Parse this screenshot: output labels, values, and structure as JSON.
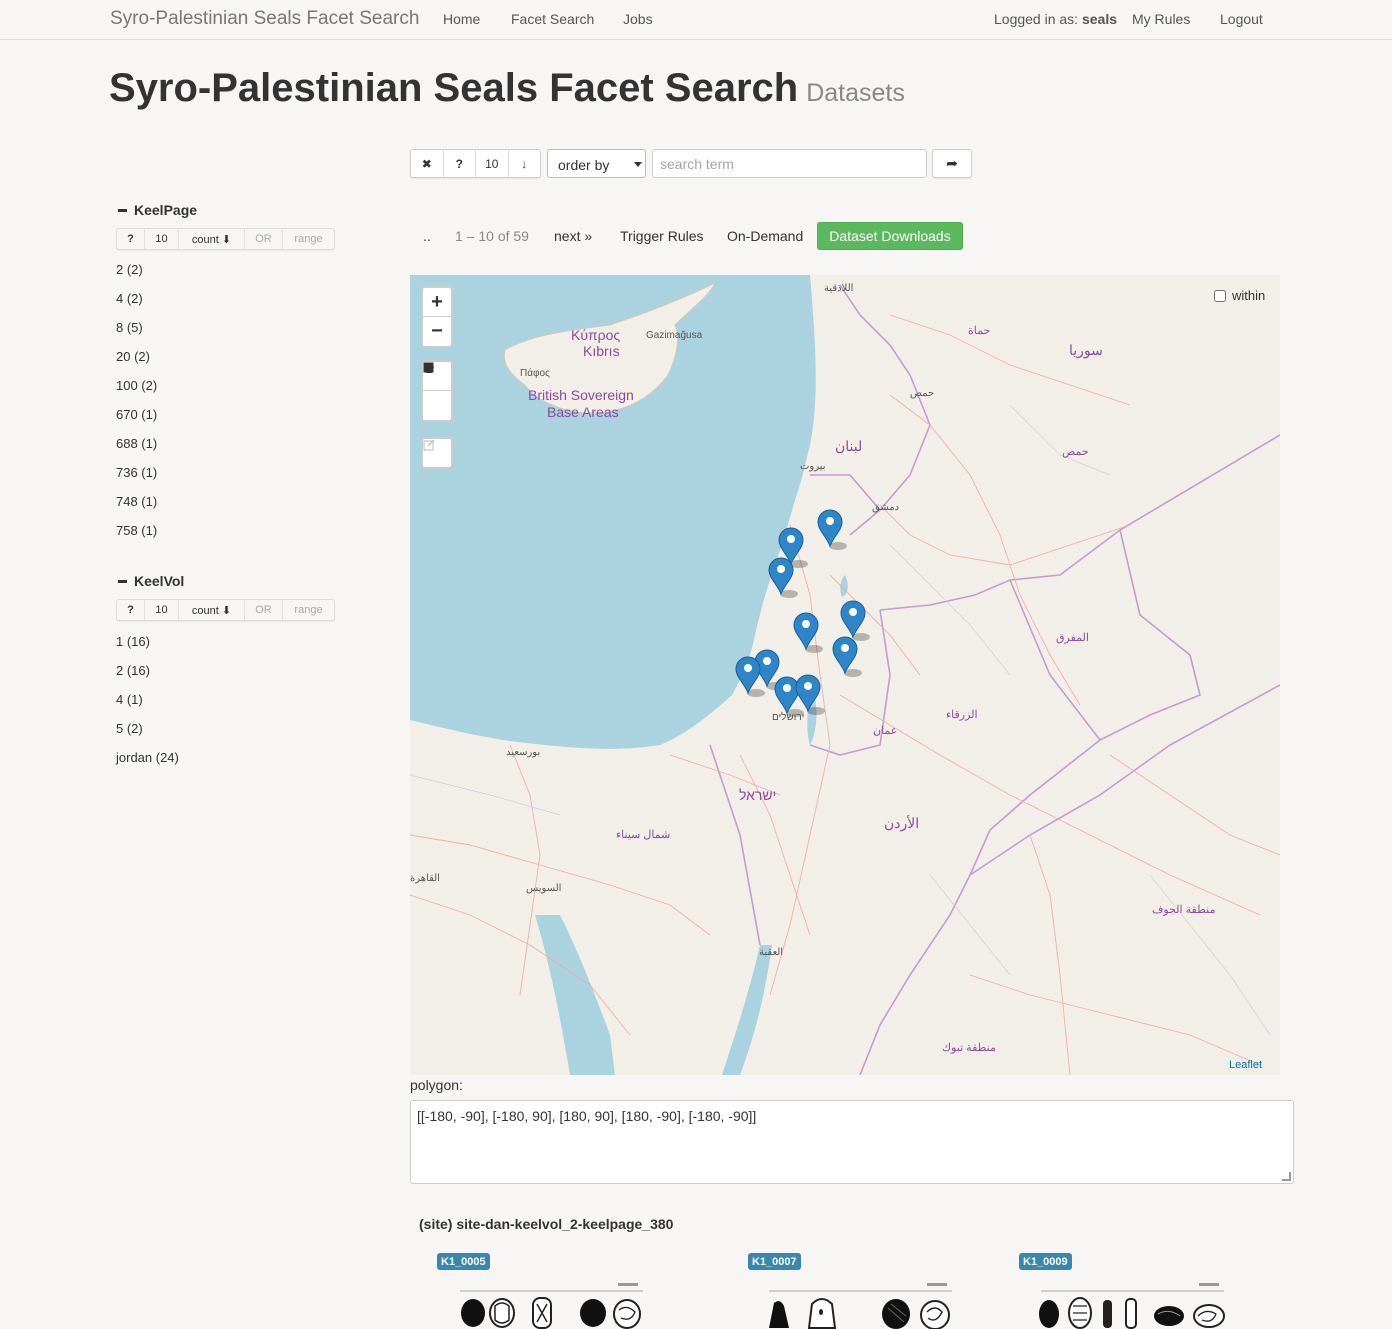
{
  "navbar": {
    "brand": "Syro-Palestinian Seals Facet Search",
    "links": [
      "Home",
      "Facet Search",
      "Jobs"
    ],
    "logged_in_prefix": "Logged in as:",
    "user": "seals",
    "my_rules": "My Rules",
    "logout": "Logout"
  },
  "header": {
    "title": "Syro-Palestinian Seals Facet Search",
    "subtitle": "Datasets"
  },
  "search": {
    "clear": "✖",
    "help": "?",
    "rows": "10",
    "sort_icon": "↓",
    "order_by": "order by",
    "placeholder": "search term",
    "go_icon": "➦"
  },
  "pager": {
    "up": "..",
    "range": "1 – 10 of 59",
    "next": "next »",
    "trigger_rules": "Trigger Rules",
    "on_demand": "On-Demand",
    "downloads": "Dataset Downloads"
  },
  "facets": [
    {
      "title": "KeelPage",
      "controls": {
        "help": "?",
        "limit": "10",
        "sort": "count ⬇",
        "or": "OR",
        "range": "range"
      },
      "items": [
        "2 (2)",
        "4 (2)",
        "8 (5)",
        "20 (2)",
        "100 (2)",
        "670 (1)",
        "688 (1)",
        "736 (1)",
        "748 (1)",
        "758 (1)"
      ]
    },
    {
      "title": "KeelVol",
      "controls": {
        "help": "?",
        "limit": "10",
        "sort": "count ⬇",
        "or": "OR",
        "range": "range"
      },
      "items": [
        "1 (16)",
        "2 (16)",
        "4 (1)",
        "5 (2)",
        "jordan (24)"
      ]
    }
  ],
  "map": {
    "zoom_in": "+",
    "zoom_out": "−",
    "within_label": "within",
    "attribution": "Leaflet",
    "labels": {
      "cyprus": "Κύπρος",
      "kibris": "Kıbrıs",
      "gazimagusa": "Gazimağusa",
      "pafos": "Πάφος",
      "sba1": "British Sovereign",
      "sba2": "Base Areas",
      "syria": "سوريا",
      "lebanon": "لبنان",
      "israel": "ישראל",
      "jordan": "الأردن",
      "damascus": "دمشق",
      "beirut": "بيروت",
      "amman": "عمان",
      "jerusalem": "ירושלים",
      "homs": "حمص",
      "latakia": "اللاذقية",
      "cairo": "القاهرة",
      "suez": "السويس",
      "aqaba": "العقبة",
      "sinai": "شمال سيناء",
      "portsaid": "بورسعيد",
      "hama": "حماة",
      "zarqa": "الزرقاء",
      "mafraq": "المفرق",
      "tabuk": "منطقة تبوك",
      "jawf": "منطقة الجوف"
    },
    "marker_icon": "map-pin-icon"
  },
  "polygon": {
    "label": "polygon:",
    "value": "[[-180, -90], [-180, 90], [180, 90], [180, -90], [-180, -90]]"
  },
  "result": {
    "title": "(site) site-dan-keelvol_2-keelpage_380",
    "items": [
      "K1_0005",
      "K1_0007",
      "K1_0009"
    ]
  },
  "colors": {
    "water": "#aad3df",
    "land": "#f2efe9",
    "border": "#b483c6",
    "marker": "#2e86c9",
    "success": "#5cb85c",
    "badge": "#3a87ad"
  }
}
